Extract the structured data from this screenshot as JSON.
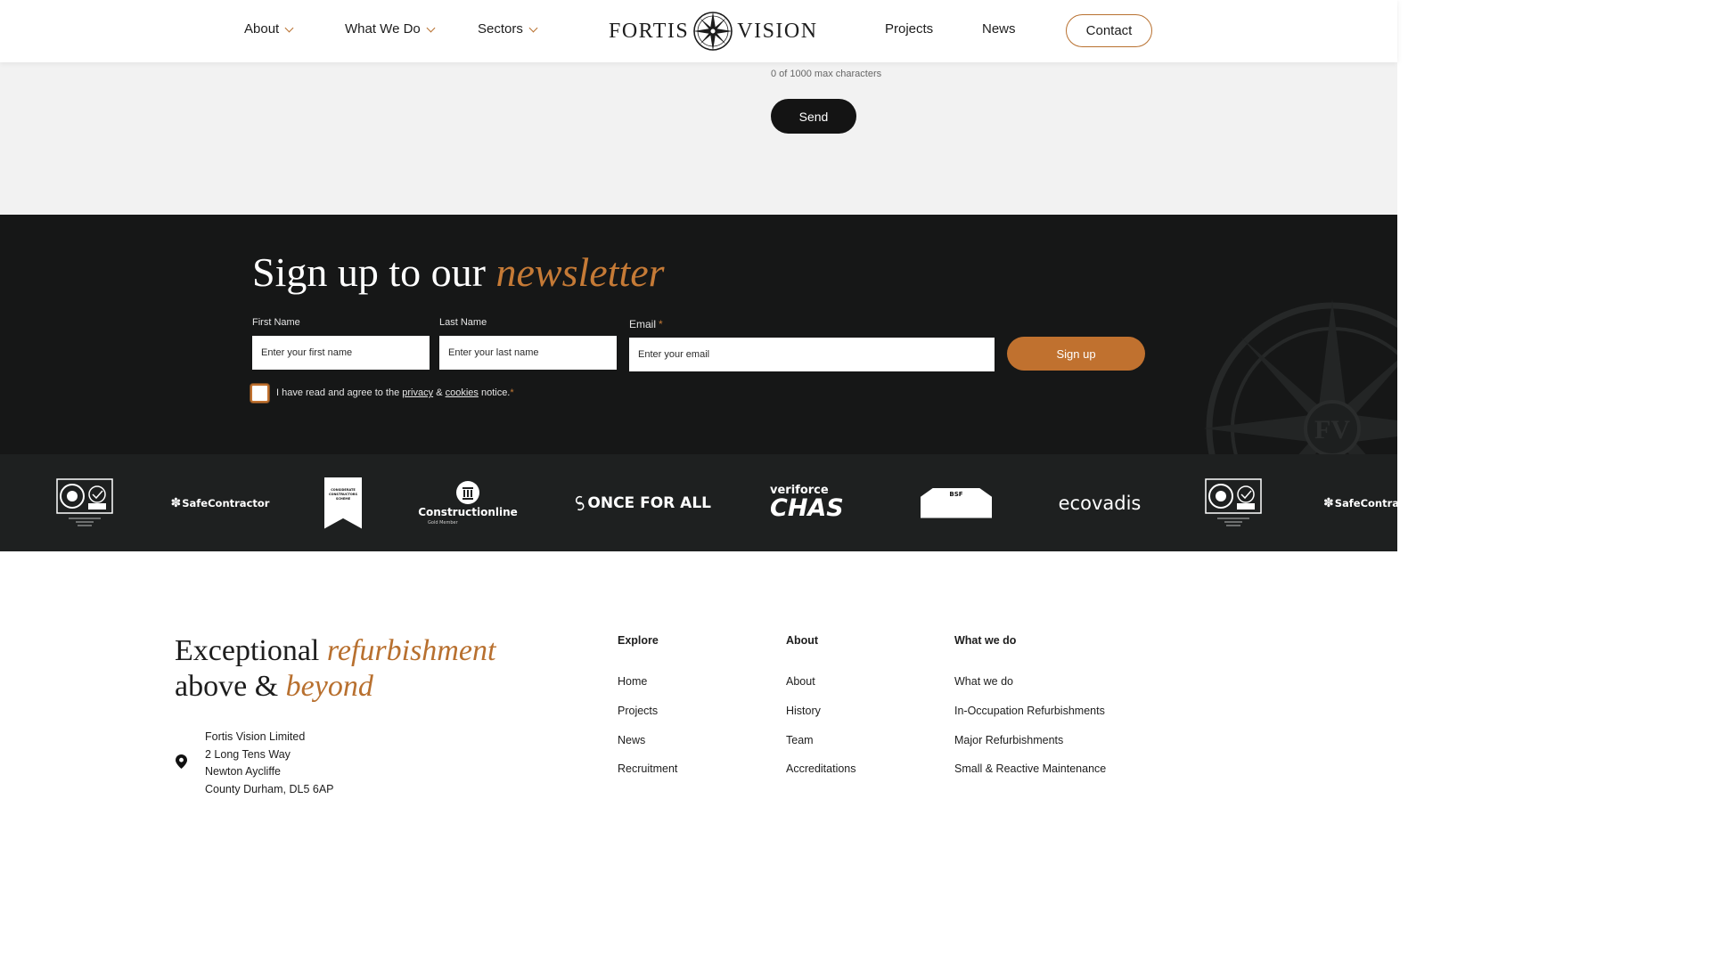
{
  "header": {
    "nav_left": [
      {
        "label": "About",
        "has_dropdown": true
      },
      {
        "label": "What We Do",
        "has_dropdown": true
      },
      {
        "label": "Sectors",
        "has_dropdown": true
      }
    ],
    "logo": {
      "left_word": "FORTIS",
      "right_word": "VISION",
      "emblem_icon": "compass-rose-icon"
    },
    "nav_right": [
      {
        "label": "Projects"
      },
      {
        "label": "News"
      }
    ],
    "contact_label": "Contact"
  },
  "form": {
    "char_count": "0 of 1000 max characters",
    "send_label": "Send"
  },
  "newsletter": {
    "title_main": "Sign up to our",
    "title_accent": "newsletter",
    "first_name": {
      "label": "First Name",
      "placeholder": "Enter your first name",
      "value": ""
    },
    "last_name": {
      "label": "Last Name",
      "placeholder": "Enter your last name",
      "value": ""
    },
    "email": {
      "label": "Email",
      "required_mark": "*",
      "placeholder": "Enter your email",
      "value": ""
    },
    "signup_label": "Sign up",
    "consent": {
      "checked": false,
      "prefix": "I have read and agree to the",
      "privacy_link": "privacy",
      "amp": "&",
      "cookies_link": "cookies",
      "suffix": "notice.",
      "required_mark": "*"
    },
    "background_emblem_icon": "compass-fv-emblem-icon"
  },
  "accreditations": {
    "logos": [
      {
        "name": "iso-ukas-certification",
        "text": ""
      },
      {
        "name": "safecontractor",
        "text": "SafeContractor"
      },
      {
        "name": "considerate-constructors-scheme",
        "text": "CONSIDERATE CONSTRUCTORS SCHEME"
      },
      {
        "name": "constructionline",
        "text": "Constructionline",
        "sub": "Gold Member"
      },
      {
        "name": "once-for-all",
        "text": "ONCE FOR ALL"
      },
      {
        "name": "veriforce-chas",
        "text_top": "veriforce",
        "text_bottom": "CHAS"
      },
      {
        "name": "bsf",
        "text": "BSF"
      },
      {
        "name": "ecovadis",
        "text": "ecovadis"
      },
      {
        "name": "iso-ukas-certification-repeat",
        "text": ""
      },
      {
        "name": "safecontractor-repeat",
        "text": "SafeContrac"
      }
    ]
  },
  "footer": {
    "tagline_1": "Exceptional",
    "tagline_2": "refurbishment",
    "tagline_3": "above",
    "tagline_4": "&",
    "tagline_5": "beyond",
    "address_lines": [
      "Fortis Vision Limited",
      "2 Long Tens Way",
      "Newton Aycliffe",
      "County Durham, DL5 6AP"
    ],
    "columns": [
      {
        "heading": "Explore",
        "links": [
          "Home",
          "Projects",
          "News",
          "Recruitment"
        ]
      },
      {
        "heading": "About",
        "links": [
          "About",
          "History",
          "Team",
          "Accreditations"
        ]
      },
      {
        "heading": "What we do",
        "links": [
          "What we do",
          "In-Occupation Refurbishments",
          "Major Refurbishments",
          "Small & Reactive Maintenance"
        ]
      }
    ]
  },
  "colors": {
    "accent": "#c0712f",
    "dark": "#161717",
    "strip": "#1e2020",
    "light_bg": "#f2f2f2"
  }
}
